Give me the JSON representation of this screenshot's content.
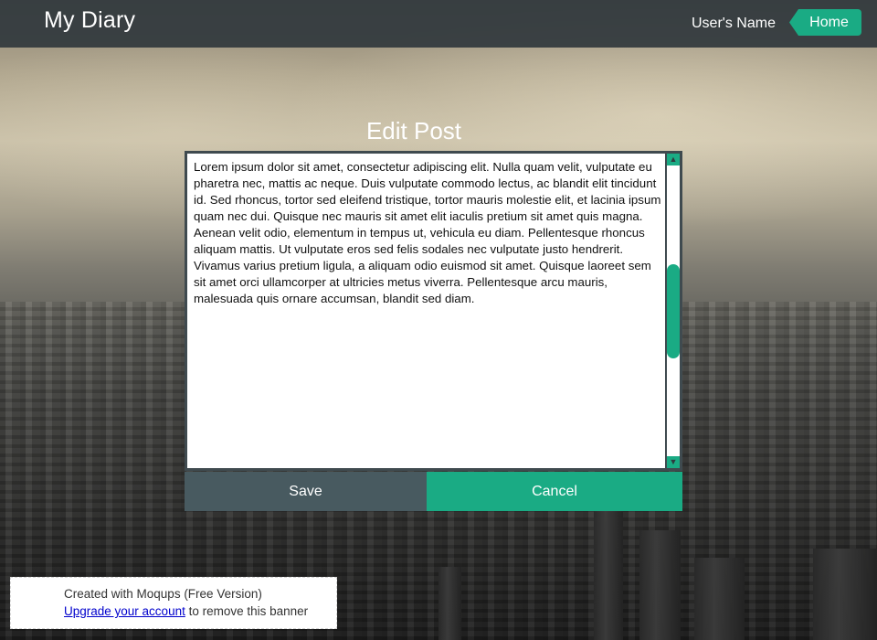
{
  "header": {
    "brand": "My Diary",
    "user_name": "User's Name",
    "home_label": "Home"
  },
  "page": {
    "title": "Edit Post"
  },
  "editor": {
    "content": "Lorem ipsum dolor sit amet, consectetur adipiscing elit. Nulla quam velit, vulputate eu pharetra nec, mattis ac neque. Duis vulputate commodo lectus, ac blandit elit tincidunt id. Sed rhoncus, tortor sed eleifend tristique, tortor mauris molestie elit, et lacinia ipsum quam nec dui. Quisque nec mauris sit amet elit iaculis pretium sit amet quis magna. Aenean velit odio, elementum in tempus ut, vehicula eu diam. Pellentesque rhoncus aliquam mattis. Ut vulputate eros sed felis sodales nec vulputate justo hendrerit. Vivamus varius pretium ligula, a aliquam odio euismod sit amet. Quisque laoreet sem sit amet orci ullamcorper at ultricies metus viverra. Pellentesque arcu mauris, malesuada quis ornare accumsan, blandit sed diam."
  },
  "actions": {
    "save_label": "Save",
    "cancel_label": "Cancel"
  },
  "banner": {
    "line1": "Created with Moqups (Free Version)",
    "link_text": "Upgrade your account",
    "line2_rest": " to remove this banner"
  },
  "colors": {
    "accent": "#1aab84",
    "header_bg": "#31393d",
    "save_bg": "#485a60"
  },
  "icons": {
    "scroll_up": "triangle-up",
    "scroll_down": "triangle-down"
  }
}
